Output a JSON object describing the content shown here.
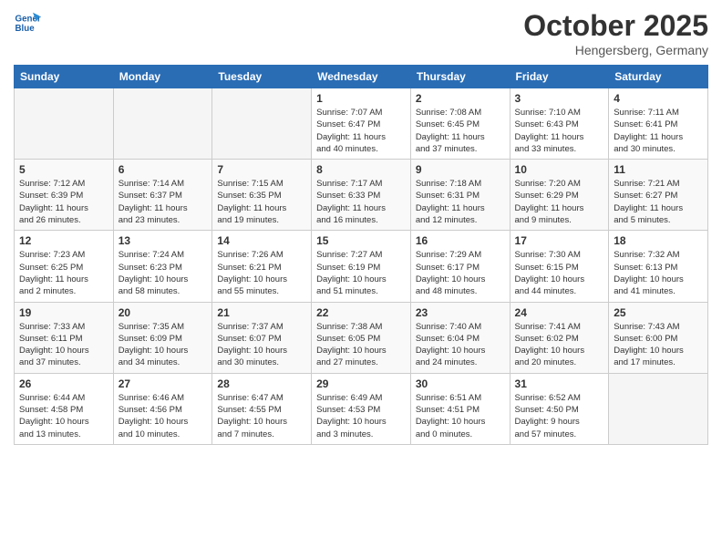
{
  "header": {
    "logo_line1": "General",
    "logo_line2": "Blue",
    "month": "October 2025",
    "location": "Hengersberg, Germany"
  },
  "weekdays": [
    "Sunday",
    "Monday",
    "Tuesday",
    "Wednesday",
    "Thursday",
    "Friday",
    "Saturday"
  ],
  "weeks": [
    [
      {
        "day": "",
        "empty": true
      },
      {
        "day": "",
        "empty": true
      },
      {
        "day": "",
        "empty": true
      },
      {
        "day": "1",
        "sunrise": "7:07 AM",
        "sunset": "6:47 PM",
        "daylight": "11 hours and 40 minutes."
      },
      {
        "day": "2",
        "sunrise": "7:08 AM",
        "sunset": "6:45 PM",
        "daylight": "11 hours and 37 minutes."
      },
      {
        "day": "3",
        "sunrise": "7:10 AM",
        "sunset": "6:43 PM",
        "daylight": "11 hours and 33 minutes."
      },
      {
        "day": "4",
        "sunrise": "7:11 AM",
        "sunset": "6:41 PM",
        "daylight": "11 hours and 30 minutes."
      }
    ],
    [
      {
        "day": "5",
        "sunrise": "7:12 AM",
        "sunset": "6:39 PM",
        "daylight": "11 hours and 26 minutes."
      },
      {
        "day": "6",
        "sunrise": "7:14 AM",
        "sunset": "6:37 PM",
        "daylight": "11 hours and 23 minutes."
      },
      {
        "day": "7",
        "sunrise": "7:15 AM",
        "sunset": "6:35 PM",
        "daylight": "11 hours and 19 minutes."
      },
      {
        "day": "8",
        "sunrise": "7:17 AM",
        "sunset": "6:33 PM",
        "daylight": "11 hours and 16 minutes."
      },
      {
        "day": "9",
        "sunrise": "7:18 AM",
        "sunset": "6:31 PM",
        "daylight": "11 hours and 12 minutes."
      },
      {
        "day": "10",
        "sunrise": "7:20 AM",
        "sunset": "6:29 PM",
        "daylight": "11 hours and 9 minutes."
      },
      {
        "day": "11",
        "sunrise": "7:21 AM",
        "sunset": "6:27 PM",
        "daylight": "11 hours and 5 minutes."
      }
    ],
    [
      {
        "day": "12",
        "sunrise": "7:23 AM",
        "sunset": "6:25 PM",
        "daylight": "11 hours and 2 minutes."
      },
      {
        "day": "13",
        "sunrise": "7:24 AM",
        "sunset": "6:23 PM",
        "daylight": "10 hours and 58 minutes."
      },
      {
        "day": "14",
        "sunrise": "7:26 AM",
        "sunset": "6:21 PM",
        "daylight": "10 hours and 55 minutes."
      },
      {
        "day": "15",
        "sunrise": "7:27 AM",
        "sunset": "6:19 PM",
        "daylight": "10 hours and 51 minutes."
      },
      {
        "day": "16",
        "sunrise": "7:29 AM",
        "sunset": "6:17 PM",
        "daylight": "10 hours and 48 minutes."
      },
      {
        "day": "17",
        "sunrise": "7:30 AM",
        "sunset": "6:15 PM",
        "daylight": "10 hours and 44 minutes."
      },
      {
        "day": "18",
        "sunrise": "7:32 AM",
        "sunset": "6:13 PM",
        "daylight": "10 hours and 41 minutes."
      }
    ],
    [
      {
        "day": "19",
        "sunrise": "7:33 AM",
        "sunset": "6:11 PM",
        "daylight": "10 hours and 37 minutes."
      },
      {
        "day": "20",
        "sunrise": "7:35 AM",
        "sunset": "6:09 PM",
        "daylight": "10 hours and 34 minutes."
      },
      {
        "day": "21",
        "sunrise": "7:37 AM",
        "sunset": "6:07 PM",
        "daylight": "10 hours and 30 minutes."
      },
      {
        "day": "22",
        "sunrise": "7:38 AM",
        "sunset": "6:05 PM",
        "daylight": "10 hours and 27 minutes."
      },
      {
        "day": "23",
        "sunrise": "7:40 AM",
        "sunset": "6:04 PM",
        "daylight": "10 hours and 24 minutes."
      },
      {
        "day": "24",
        "sunrise": "7:41 AM",
        "sunset": "6:02 PM",
        "daylight": "10 hours and 20 minutes."
      },
      {
        "day": "25",
        "sunrise": "7:43 AM",
        "sunset": "6:00 PM",
        "daylight": "10 hours and 17 minutes."
      }
    ],
    [
      {
        "day": "26",
        "sunrise": "6:44 AM",
        "sunset": "4:58 PM",
        "daylight": "10 hours and 13 minutes."
      },
      {
        "day": "27",
        "sunrise": "6:46 AM",
        "sunset": "4:56 PM",
        "daylight": "10 hours and 10 minutes."
      },
      {
        "day": "28",
        "sunrise": "6:47 AM",
        "sunset": "4:55 PM",
        "daylight": "10 hours and 7 minutes."
      },
      {
        "day": "29",
        "sunrise": "6:49 AM",
        "sunset": "4:53 PM",
        "daylight": "10 hours and 3 minutes."
      },
      {
        "day": "30",
        "sunrise": "6:51 AM",
        "sunset": "4:51 PM",
        "daylight": "10 hours and 0 minutes."
      },
      {
        "day": "31",
        "sunrise": "6:52 AM",
        "sunset": "4:50 PM",
        "daylight": "9 hours and 57 minutes."
      },
      {
        "day": "",
        "empty": true
      }
    ]
  ]
}
